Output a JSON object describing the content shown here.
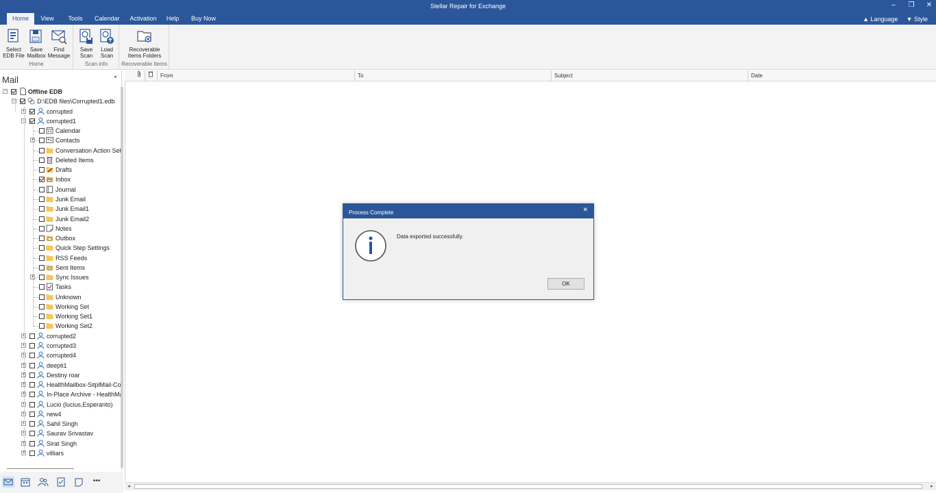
{
  "app": {
    "title": "Stellar Repair for Exchange"
  },
  "window_controls": {
    "minimize": "–",
    "restore": "❐",
    "close": "✕"
  },
  "menu": {
    "tabs": [
      {
        "label": "Home",
        "active": true
      },
      {
        "label": "View"
      },
      {
        "label": "Tools"
      },
      {
        "label": "Calendar"
      },
      {
        "label": "Activation"
      },
      {
        "label": "Help"
      },
      {
        "label": "Buy Now"
      }
    ],
    "language": "Language",
    "style": "Style"
  },
  "ribbon": {
    "groups": {
      "home": "Home",
      "scan_info": "Scan info",
      "recoverable": "Recoverable Items"
    },
    "buttons": {
      "select_edb": "Select EDB File",
      "save_mailbox": "Save Mailbox",
      "find_message": "Find Message",
      "save_scan": "Save Scan",
      "load_scan": "Load Scan",
      "recoverable_folders": "Recoverable Items Folders"
    }
  },
  "left_pane": {
    "heading": "Mail",
    "collapse_glyph": "◂",
    "root": "Offline EDB",
    "edb_path": "D:\\EDB files\\Corrupted1.edb",
    "mailboxes_top": [
      "corrupted",
      "corrupted1"
    ],
    "folders": [
      {
        "label": "Calendar",
        "icon": "calendar-icon",
        "expandable": false,
        "checked": false
      },
      {
        "label": "Contacts",
        "icon": "contacts-icon",
        "expandable": true,
        "checked": false
      },
      {
        "label": "Conversation Action Sett",
        "icon": "folder-icon",
        "expandable": false,
        "checked": false
      },
      {
        "label": "Deleted Items",
        "icon": "trash-icon",
        "expandable": false,
        "checked": false
      },
      {
        "label": "Drafts",
        "icon": "drafts-icon",
        "expandable": false,
        "checked": false
      },
      {
        "label": "Inbox",
        "icon": "inbox-icon",
        "expandable": false,
        "checked": true
      },
      {
        "label": "Journal",
        "icon": "journal-icon",
        "expandable": false,
        "checked": false
      },
      {
        "label": "Junk Email",
        "icon": "folder-icon",
        "expandable": false,
        "checked": false
      },
      {
        "label": "Junk Email1",
        "icon": "folder-icon",
        "expandable": false,
        "checked": false
      },
      {
        "label": "Junk Email2",
        "icon": "folder-icon",
        "expandable": false,
        "checked": false
      },
      {
        "label": "Notes",
        "icon": "notes-icon",
        "expandable": false,
        "checked": false
      },
      {
        "label": "Outbox",
        "icon": "outbox-icon",
        "expandable": false,
        "checked": false
      },
      {
        "label": "Quick Step Settings",
        "icon": "folder-icon",
        "expandable": false,
        "checked": false
      },
      {
        "label": "RSS Feeds",
        "icon": "folder-icon",
        "expandable": false,
        "checked": false
      },
      {
        "label": "Sent Items",
        "icon": "sent-icon",
        "expandable": false,
        "checked": false
      },
      {
        "label": "Sync Issues",
        "icon": "folder-icon",
        "expandable": true,
        "checked": false
      },
      {
        "label": "Tasks",
        "icon": "tasks-icon",
        "expandable": false,
        "checked": false
      },
      {
        "label": "Unknown",
        "icon": "folder-icon",
        "expandable": false,
        "checked": false
      },
      {
        "label": "Working Set",
        "icon": "folder-icon",
        "expandable": false,
        "checked": false
      },
      {
        "label": "Working Set1",
        "icon": "folder-icon",
        "expandable": false,
        "checked": false
      },
      {
        "label": "Working Set2",
        "icon": "folder-icon",
        "expandable": false,
        "checked": false
      }
    ],
    "mailboxes_bottom": [
      "corrupted2",
      "corrupted3",
      "corrupted4",
      "deepti1",
      "Destiny roar",
      "HealthMailbox-SitplMail-Cor",
      "In-Place Archive - HealthMai",
      "Lucio (lucius,Esperanto)",
      "new4",
      "Sahil Singh",
      "Saurav Srivastav",
      "Sirat Singh",
      "villiars"
    ]
  },
  "bottom_nav": {
    "more": "•••"
  },
  "grid": {
    "columns": [
      "From",
      "To",
      "Subject",
      "Date"
    ]
  },
  "dialog": {
    "title": "Process Complete",
    "close": "✕",
    "message": "Data exported successfully.",
    "ok": "OK"
  },
  "colors": {
    "title_bar": "#2b579a",
    "ribbon": "#f3f3f3",
    "folder": "#f7c55a",
    "user": "#2f6fb5"
  }
}
